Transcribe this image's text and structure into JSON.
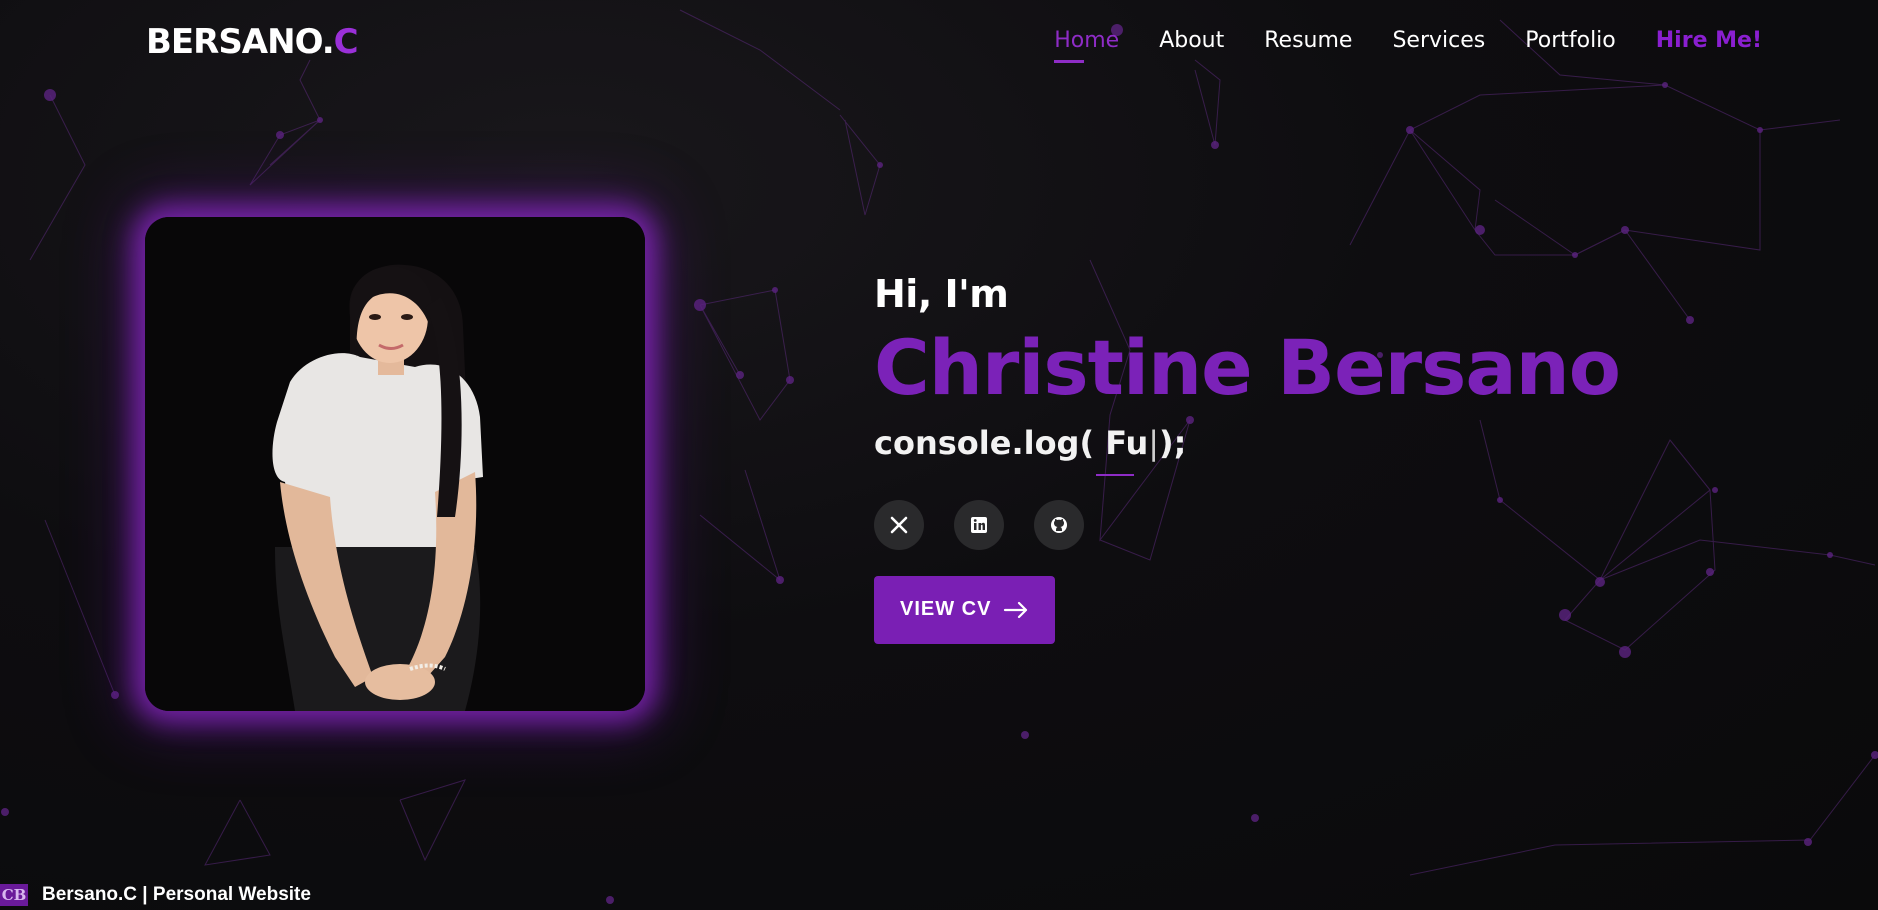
{
  "brand": {
    "logo_main": "BERSANO.",
    "logo_accent": "C"
  },
  "nav": {
    "items": [
      {
        "label": "Home",
        "active": true
      },
      {
        "label": "About"
      },
      {
        "label": "Resume"
      },
      {
        "label": "Services"
      },
      {
        "label": "Portfolio"
      },
      {
        "label": "Hire Me!"
      }
    ]
  },
  "hero": {
    "greeting": "Hi, I'm",
    "name": "Christine Bersano",
    "typed_prefix": "console.log(",
    "typed_arg": " Fu",
    "typed_cursor": "|",
    "typed_suffix": ");",
    "cv_button": "VIEW CV"
  },
  "socials": [
    {
      "icon": "x-twitter-icon"
    },
    {
      "icon": "linkedin-icon"
    },
    {
      "icon": "github-icon"
    }
  ],
  "footer": {
    "favicon_text": "CB",
    "site_title": "Bersano.C | Personal Website"
  },
  "colors": {
    "accent": "#7b22b8",
    "accent_bright": "#9a30d8",
    "background": "#0c0b0d",
    "social_bg": "#2a2a2c"
  }
}
